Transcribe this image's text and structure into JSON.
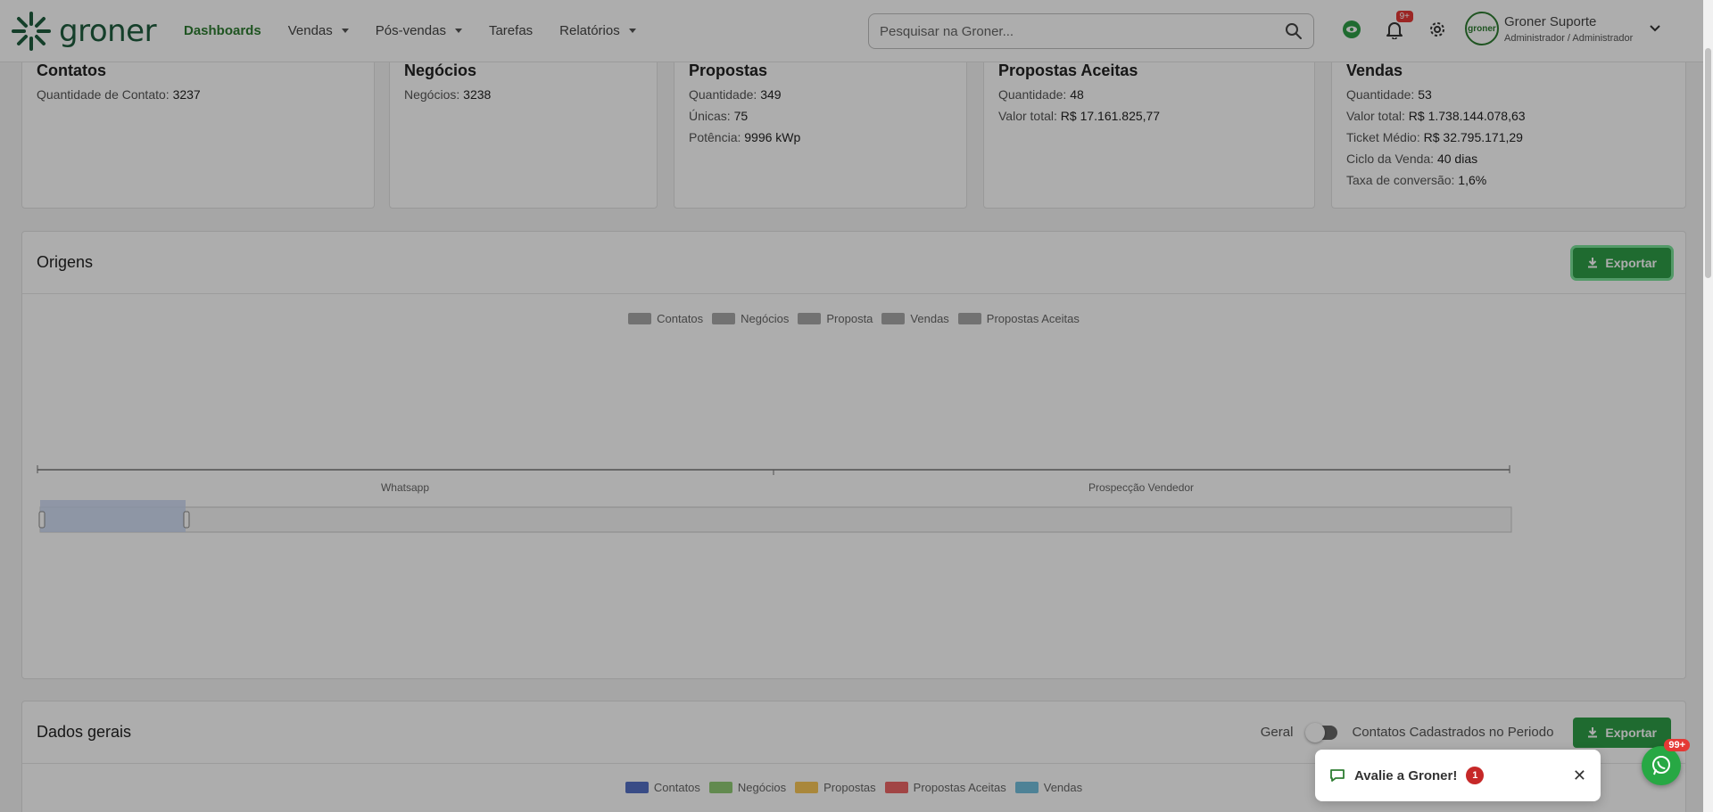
{
  "nav": {
    "brand": "groner",
    "items": [
      {
        "label": "Dashboards",
        "active": true,
        "dropdown": false
      },
      {
        "label": "Vendas",
        "active": false,
        "dropdown": true
      },
      {
        "label": "Pós-vendas",
        "active": false,
        "dropdown": true
      },
      {
        "label": "Tarefas",
        "active": false,
        "dropdown": false
      },
      {
        "label": "Relatórios",
        "active": false,
        "dropdown": true
      }
    ],
    "search_placeholder": "Pesquisar na Groner...",
    "notifications_badge": "9+",
    "user_name": "Groner Suporte",
    "user_role": "Administrador / Administrador",
    "avatar_text": "groner"
  },
  "stats": {
    "contatos": {
      "title": "Contatos",
      "lines": [
        {
          "label": "Quantidade de Contato:",
          "value": "3237"
        }
      ]
    },
    "negocios": {
      "title": "Negócios",
      "lines": [
        {
          "label": "Negócios:",
          "value": "3238"
        }
      ]
    },
    "propostas": {
      "title": "Propostas",
      "lines": [
        {
          "label": "Quantidade:",
          "value": "349"
        },
        {
          "label": "Únicas:",
          "value": "75"
        },
        {
          "label": "Potência:",
          "value": "9996 kWp"
        }
      ]
    },
    "aceitas": {
      "title": "Propostas Aceitas",
      "lines": [
        {
          "label": "Quantidade:",
          "value": "48"
        },
        {
          "label": "Valor total:",
          "value": "R$ 17.161.825,77"
        }
      ]
    },
    "vendas": {
      "title": "Vendas",
      "lines": [
        {
          "label": "Quantidade:",
          "value": "53"
        },
        {
          "label": "Valor total:",
          "value": "R$ 1.738.144.078,63"
        },
        {
          "label": "Ticket Médio:",
          "value": "R$ 32.795.171,29"
        },
        {
          "label": "Ciclo da Venda:",
          "value": "40 dias"
        },
        {
          "label": "Taxa de conversão:",
          "value": "1,6%"
        }
      ]
    }
  },
  "origens": {
    "title": "Origens",
    "export_label": "Exportar",
    "legend": [
      {
        "label": "Contatos",
        "color": "#a8a8a8"
      },
      {
        "label": "Negócios",
        "color": "#a8a8a8"
      },
      {
        "label": "Proposta",
        "color": "#a8a8a8"
      },
      {
        "label": "Vendas",
        "color": "#a8a8a8"
      },
      {
        "label": "Propostas Aceitas",
        "color": "#a8a8a8"
      }
    ],
    "categories": [
      "Whatsapp",
      "Prospecção Vendedor"
    ]
  },
  "dados_gerais": {
    "title": "Dados gerais",
    "toggle_left": "Geral",
    "toggle_right": "Contatos Cadastrados no Periodo",
    "export_label": "Exportar",
    "legend": [
      {
        "label": "Contatos",
        "color": "#5470c6"
      },
      {
        "label": "Negócios",
        "color": "#91cc75"
      },
      {
        "label": "Propostas",
        "color": "#fac858"
      },
      {
        "label": "Propostas Aceitas",
        "color": "#ee6666"
      },
      {
        "label": "Vendas",
        "color": "#73c0de"
      }
    ]
  },
  "toast": {
    "text": "Avalie a Groner!",
    "count": "1"
  },
  "whatsapp_badge": "99+",
  "colors": {
    "brand_green": "#2e7d32",
    "export_green": "#2e9e48"
  }
}
